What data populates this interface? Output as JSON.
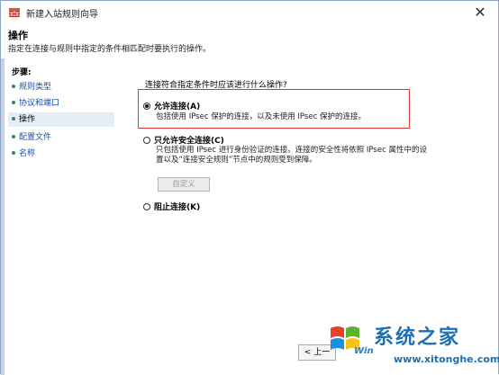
{
  "window": {
    "title": "新建入站规则向导"
  },
  "header": {
    "title": "操作",
    "subtitle": "指定在连接与规则中指定的条件相匹配时要执行的操作。"
  },
  "steps": {
    "title": "步骤:",
    "items": [
      {
        "label": "规则类型"
      },
      {
        "label": "协议和端口"
      },
      {
        "label": "操作"
      },
      {
        "label": "配置文件"
      },
      {
        "label": "名称"
      }
    ]
  },
  "main": {
    "question": "连接符合指定条件时应该进行什么操作?",
    "options": [
      {
        "label": "允许连接(A)",
        "desc": [
          "包括使用 IPsec 保护的连接，以及未使用 IPsec 保护的连接。"
        ],
        "checked": true
      },
      {
        "label": "只允许安全连接(C)",
        "desc": [
          "只包括使用 IPsec 进行身份验证的连接。连接的安全性将依照 IPsec 属性中的设",
          "置以及“连接安全规则”节点中的规则受到保障。"
        ],
        "checked": false
      },
      {
        "label": "阻止连接(K)",
        "desc": [],
        "checked": false
      }
    ],
    "custom_button": "自定义"
  },
  "footer": {
    "back_label": "< 上一"
  },
  "watermark": {
    "main": "系统之家",
    "url": "www.xitonghe.com",
    "side": "Win"
  }
}
